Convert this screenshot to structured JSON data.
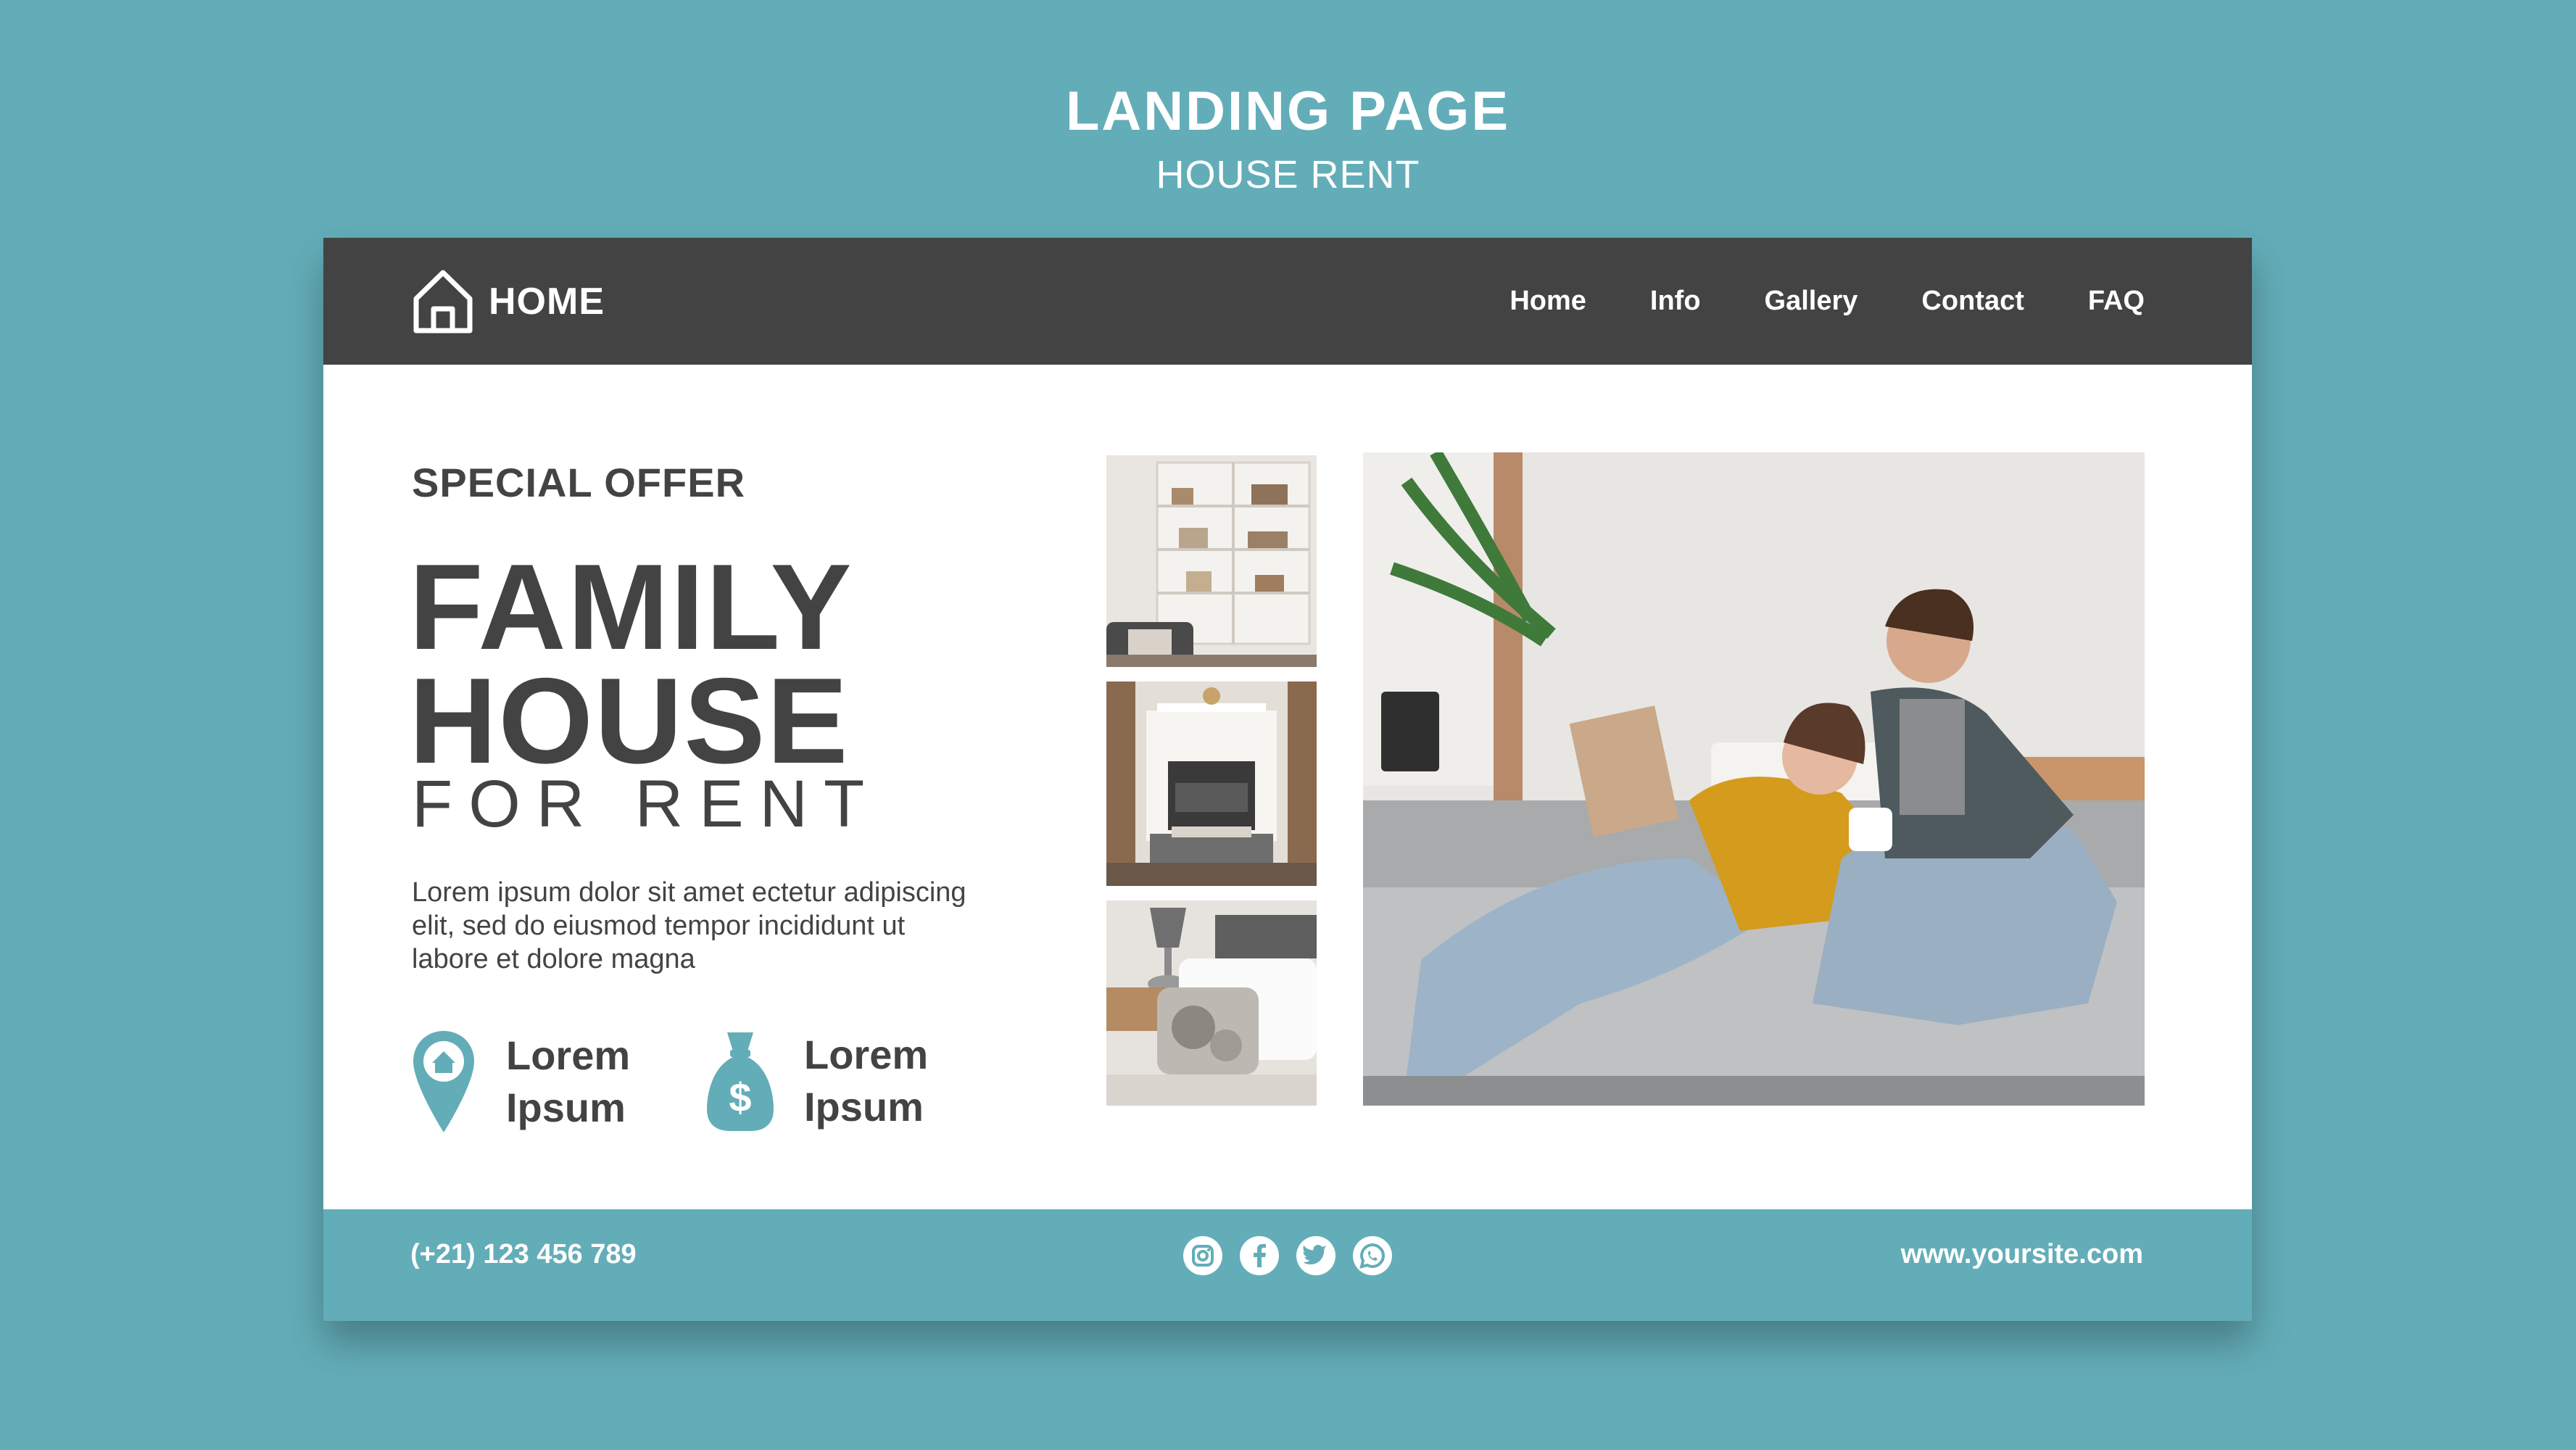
{
  "presentation": {
    "title": "LANDING PAGE",
    "subtitle": "HOUSE RENT"
  },
  "colors": {
    "background": "#63adb8",
    "navbar": "#434343",
    "text_dark": "#434343",
    "accent": "#63adb8",
    "card": "#ffffff"
  },
  "navbar": {
    "brand_label": "HOME",
    "brand_icon": "house-icon",
    "links": [
      {
        "label": "Home"
      },
      {
        "label": "Info"
      },
      {
        "label": "Gallery"
      },
      {
        "label": "Contact"
      },
      {
        "label": "FAQ"
      }
    ]
  },
  "hero": {
    "eyebrow": "SPECIAL OFFER",
    "headline_line1": "FAMILY",
    "headline_line2": "HOUSE",
    "headline_line3": "FOR RENT",
    "body": "Lorem ipsum dolor sit amet ectetur adipiscing elit, sed do eiusmod tempor incididunt ut labore et dolore magna",
    "features": [
      {
        "icon": "location-pin-house-icon",
        "line1": "Lorem",
        "line2": "Ipsum"
      },
      {
        "icon": "money-bag-icon",
        "line1": "Lorem",
        "line2": "Ipsum"
      }
    ]
  },
  "gallery": {
    "thumbnails": [
      "bookshelf-room-photo",
      "fireplace-living-room-photo",
      "bedroom-lamp-photo"
    ],
    "main_photo": "couple-on-sofa-photo"
  },
  "footer": {
    "phone": "(+21) 123 456 789",
    "social_icons": [
      "instagram-icon",
      "facebook-icon",
      "twitter-icon",
      "whatsapp-icon"
    ],
    "website": "www.yoursite.com"
  }
}
